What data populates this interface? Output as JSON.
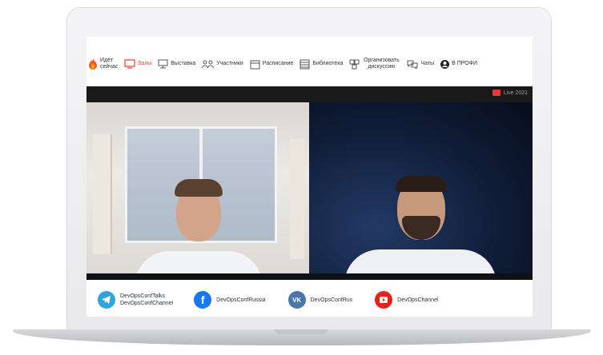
{
  "nav": {
    "items": [
      {
        "id": "live",
        "label_lines": [
          "Идёт",
          "сейчас"
        ]
      },
      {
        "id": "halls",
        "label": "Залы",
        "active": true
      },
      {
        "id": "expo",
        "label": "Выставка"
      },
      {
        "id": "participants",
        "label": "Участники"
      },
      {
        "id": "schedule",
        "label": "Расписание"
      },
      {
        "id": "library",
        "label": "Библиотека"
      },
      {
        "id": "discussion",
        "label_lines": [
          "Организовать",
          "дискуссию"
        ]
      },
      {
        "id": "chats",
        "label": "Чаты"
      },
      {
        "id": "profile",
        "label": "В ПРОФИ"
      }
    ]
  },
  "video": {
    "brand_text": "Live 2021"
  },
  "socials": [
    {
      "network": "telegram",
      "color": "#2ca5e0",
      "lines": [
        "DevOpsConfTalks",
        "DevOpsConfChannel"
      ]
    },
    {
      "network": "facebook",
      "color": "#1877f2",
      "lines": [
        "DevOpsConfRussia"
      ]
    },
    {
      "network": "vk",
      "color": "#4a76a8",
      "lines": [
        "DevOpsConfRus"
      ]
    },
    {
      "network": "youtube",
      "color": "#e62117",
      "lines": [
        "DevOpsChannel"
      ]
    }
  ],
  "colors": {
    "accent": "#e53935",
    "video_dark": "#191919"
  }
}
